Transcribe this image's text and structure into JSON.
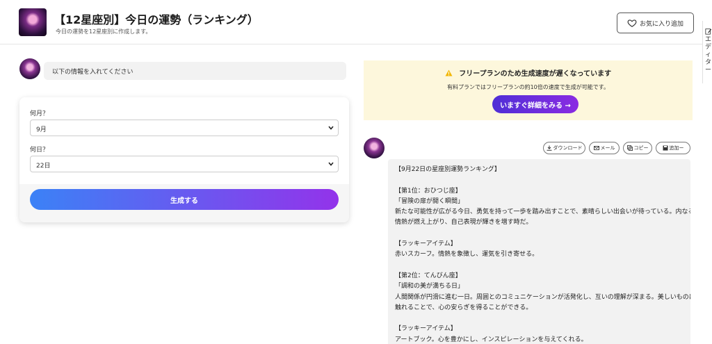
{
  "header": {
    "title": "【12星座別】今日の運勢（ランキング）",
    "subtitle": "今日の運勢を12星座別に作成します。",
    "favorite_label": "お気に入り追加"
  },
  "edge_panel": {
    "label": "エディター"
  },
  "prompt": {
    "text": "以下の情報を入れてください"
  },
  "form": {
    "month_label": "何月？",
    "month_value": "9月",
    "day_label": "何日？",
    "day_value": "22日",
    "generate_label": "生成する"
  },
  "notice": {
    "title": "フリープランのため生成速度が遅くなっています",
    "text": "有料プランではフリープランの約10倍の速度で生成が可能です。",
    "button_label": "いますぐ詳細をみる →"
  },
  "actions": {
    "download": "ダウンロード",
    "mail": "メール",
    "copy": "コピー",
    "add": "追加ー"
  },
  "result": {
    "lines": [
      "【9月22日の星座別運勢ランキング】",
      "",
      "【第1位：おひつじ座】",
      "「冒険の扉が開く瞬間」",
      "新たな可能性が広がる今日、勇気を持って一歩を踏み出すことで、素晴らしい出会いが待っている。内なる",
      "情熱が燃え上がり、自己表現が輝きを増す時だ。",
      "",
      "【ラッキーアイテム】",
      "赤いスカーフ。情熱を象徴し、運気を引き寄せる。",
      "",
      "【第2位：てんびん座】",
      "「調和の美が満ちる日」",
      "人間関係が円滑に進む一日。周囲とのコミュニケーションが活発化し、互いの理解が深まる。美しいものに",
      "触れることで、心の安らぎを得ることができる。",
      "",
      "【ラッキーアイテム】",
      "アートブック。心を豊かにし、インスピレーションを与えてくれる。"
    ]
  },
  "colors": {
    "generate_gradient_start": "#3b82f6",
    "generate_gradient_end": "#9333ea",
    "notice_background": "#fdf7dc",
    "notice_button": "#5b2ee0",
    "warning": "#f2b600"
  },
  "icons": [
    "heart-icon",
    "edit-icon",
    "warning-icon",
    "download-icon",
    "mail-icon",
    "copy-icon",
    "save-icon",
    "chevron-down-icon"
  ]
}
